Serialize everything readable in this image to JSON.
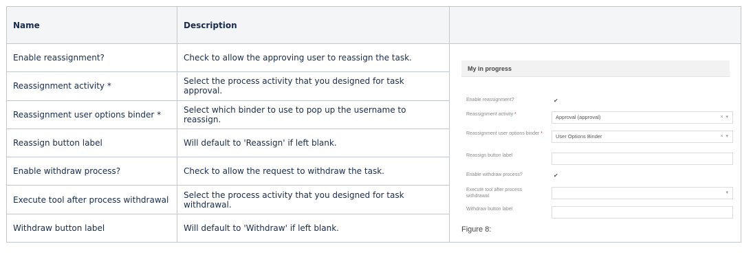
{
  "table": {
    "headers": {
      "name": "Name",
      "description": "Description",
      "figure": ""
    },
    "rows": [
      {
        "name": "Enable reassignment?",
        "description": "Check to allow the approving user to reassign the task."
      },
      {
        "name": "Reassignment activity *",
        "description": "Select the process activity that you designed for task approval."
      },
      {
        "name": "Reassignment user options binder *",
        "description": "Select which binder to use to pop up the username to reassign."
      },
      {
        "name": "Reassign button label",
        "description": "Will default to 'Reassign' if left blank."
      },
      {
        "name": "Enable withdraw process?",
        "description": "Check to allow the request to withdraw the task."
      },
      {
        "name": "Execute tool after process withdrawal",
        "description": "Select the process activity that you designed for task withdrawal."
      },
      {
        "name": "Withdraw button label",
        "description": "Will default to 'Withdraw' if left blank."
      }
    ]
  },
  "figure": {
    "header": "My in progress",
    "caption": "Figure 8:",
    "fields": [
      {
        "label": "Enable reassignment?",
        "type": "checkbox",
        "checked": true,
        "value": ""
      },
      {
        "label": "Reassignment activity",
        "required": true,
        "type": "select",
        "value": "Approval (approval)"
      },
      {
        "label": "Reassignment user options binder",
        "required": true,
        "type": "select",
        "value": "User Options Binder"
      },
      {
        "label": "Reassign button label",
        "type": "text",
        "value": ""
      },
      {
        "label": "Enable withdraw process?",
        "type": "checkbox",
        "checked": true,
        "value": ""
      },
      {
        "label": "Execute tool after process withdrawal",
        "type": "select-empty",
        "value": ""
      },
      {
        "label": "Withdraw button label",
        "type": "text",
        "value": ""
      }
    ],
    "required_mark": "*",
    "check_glyph": "✔",
    "clear_glyph": "×",
    "caret_glyph": "▾"
  }
}
